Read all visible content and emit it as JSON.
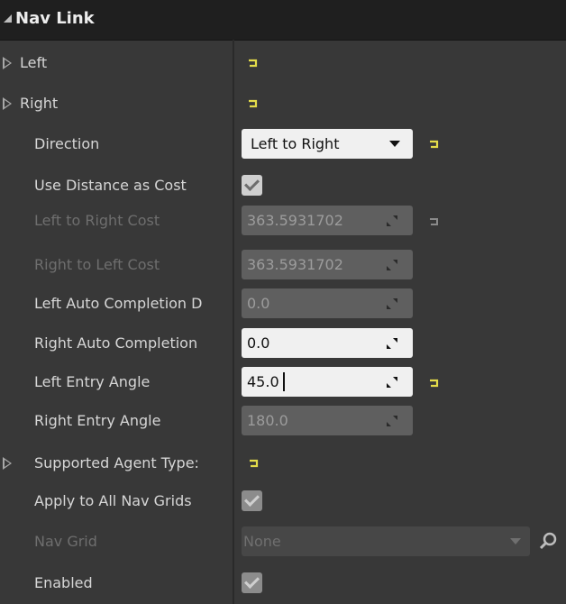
{
  "section": {
    "title": "Nav Link"
  },
  "rows": {
    "left": {
      "label": "Left"
    },
    "right": {
      "label": "Right"
    },
    "direction": {
      "label": "Direction",
      "value": "Left to Right"
    },
    "use_distance": {
      "label": "Use Distance as Cost",
      "checked": true
    },
    "lr_cost": {
      "label": "Left to Right Cost",
      "value": "363.5931702"
    },
    "rl_cost": {
      "label": "Right to Left Cost",
      "value": "363.5931702"
    },
    "left_auto": {
      "label": "Left Auto Completion D",
      "value": "0.0"
    },
    "right_auto": {
      "label": "Right Auto Completion",
      "value": "0.0"
    },
    "left_entry": {
      "label": "Left Entry Angle",
      "value": "45.0"
    },
    "right_entry": {
      "label": "Right Entry Angle",
      "value": "180.0"
    },
    "supported": {
      "label": "Supported Agent Type:"
    },
    "apply_all": {
      "label": "Apply to All Nav Grids",
      "checked": true
    },
    "nav_grid": {
      "label": "Nav Grid",
      "value": "None"
    },
    "enabled": {
      "label": "Enabled",
      "checked": true
    }
  },
  "colors": {
    "reset_arrow": "#e3dc4a",
    "reset_arrow_dim": "#8a8a8a"
  }
}
